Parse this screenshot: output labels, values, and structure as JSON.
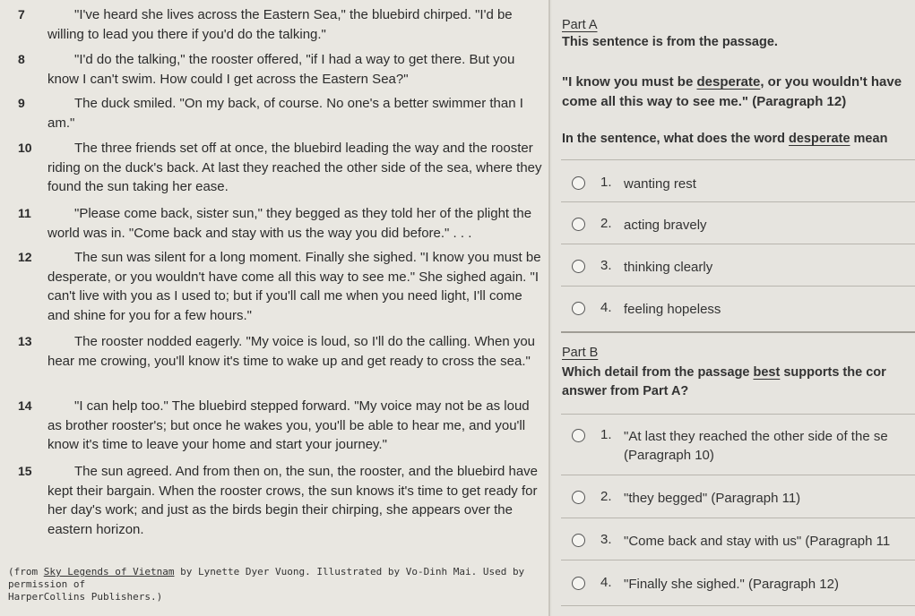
{
  "passage": {
    "paragraphs": [
      {
        "num": "7",
        "text": "\"I've heard she lives across the Eastern Sea,\" the bluebird chirped. \"I'd be willing to lead you there if you'd do the talking.\""
      },
      {
        "num": "8",
        "text": "\"I'd do the talking,\" the rooster offered, \"if I had a way to get there. But you know I can't swim. How could I get across the Eastern Sea?\""
      },
      {
        "num": "9",
        "text": "The duck smiled. \"On my back, of course. No one's a better swimmer than I am.\""
      },
      {
        "num": "10",
        "text": "The three friends set off at once, the bluebird leading the way and the rooster riding on the duck's back. At last they reached the other side of the sea, where they found the sun taking her ease."
      },
      {
        "num": "11",
        "text": "\"Please come back, sister sun,\" they begged as they told her of the plight the world was in. \"Come back and stay with us the way you did before.\" . . ."
      },
      {
        "num": "12",
        "text": "The sun was silent for a long moment. Finally she sighed. \"I know you must be desperate, or you wouldn't have come all this way to see me.\" She sighed again. \"I can't live with you as I used to; but if you'll call me when you need light, I'll come and shine for you for a few hours.\""
      },
      {
        "num": "13",
        "text": "The rooster nodded eagerly. \"My voice is loud, so I'll do the calling. When you hear me crowing, you'll know it's time to wake up and get ready to cross the sea.\""
      },
      {
        "num": "14",
        "text": "\"I can help too.\" The bluebird stepped forward. \"My voice may not be as loud as brother rooster's; but once he wakes you, you'll be able to hear me, and you'll know it's time to leave your home and start your journey.\""
      },
      {
        "num": "15",
        "text": "The sun agreed. And from then on, the sun, the rooster, and the bluebird have kept their bargain. When the rooster crows, the sun knows it's time to get ready for her day's work; and just as the birds begin their chirping, she appears over the eastern horizon."
      }
    ],
    "credit": {
      "prefix": "(from ",
      "book": "Sky Legends of Vietnam",
      "rest": " by Lynette Dyer Vuong. Illustrated by Vo-Dinh Mai. Used by permission of",
      "line2": "HarperCollins Publishers.)"
    }
  },
  "part_a": {
    "title": "Part A",
    "intro": "This sentence is from the passage.",
    "quote_line1_pre": "\"I know you must be ",
    "quote_word": "desperate",
    "quote_line1_post": ", or you wouldn't have",
    "quote_line2": "come all this way to see me.\" (Paragraph 12)",
    "question_pre": "In the sentence, what does the word ",
    "question_word": "desperate",
    "question_post": " mean",
    "options": [
      {
        "num": "1.",
        "label": "wanting rest"
      },
      {
        "num": "2.",
        "label": "acting bravely"
      },
      {
        "num": "3.",
        "label": "thinking clearly"
      },
      {
        "num": "4.",
        "label": "feeling hopeless"
      }
    ]
  },
  "part_b": {
    "title": "Part B",
    "question_pre": "Which detail from the passage ",
    "question_word": "best",
    "question_post": " supports the cor",
    "question_line2": "answer from Part A?",
    "options": [
      {
        "num": "1.",
        "label": "\"At last they reached the other side of the se",
        "label2": "(Paragraph 10)"
      },
      {
        "num": "2.",
        "label": "\"they begged\" (Paragraph 11)"
      },
      {
        "num": "3.",
        "label": "\"Come back and stay with us\" (Paragraph 11"
      },
      {
        "num": "4.",
        "label": "\"Finally she sighed.\" (Paragraph 12)"
      }
    ]
  }
}
